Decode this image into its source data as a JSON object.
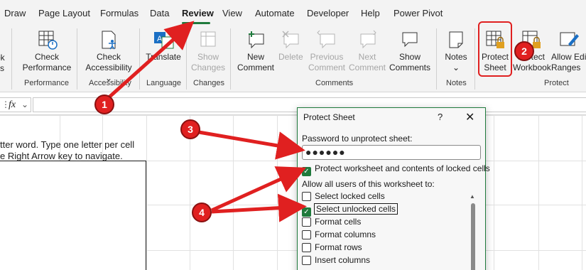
{
  "menu": {
    "tabs": [
      "Draw",
      "Page Layout",
      "Formulas",
      "Data",
      "Review",
      "View",
      "Automate",
      "Developer",
      "Help",
      "Power Pivot"
    ],
    "active_tab": "Review"
  },
  "ribbon": {
    "clipped_left": {
      "line1": "ok",
      "line2": "cs"
    },
    "check_performance": "Check Performance",
    "check_accessibility": "Check Accessibility",
    "translate": "Translate",
    "show_changes": "Show Changes",
    "new_comment": "New Comment",
    "delete": "Delete",
    "previous_comment": "Previous Comment",
    "next_comment": "Next Comment",
    "show_comments": "Show Comments",
    "notes": "Notes",
    "protect_sheet": "Protect Sheet",
    "protect_workbook": "Protect Workbook",
    "allow_edit_ranges": "Allow Edi Ranges",
    "groups": {
      "performance": "Performance",
      "accessibility": "Accessibility",
      "language": "Language",
      "changes": "Changes",
      "comments": "Comments",
      "notes": "Notes",
      "protect": "Protect"
    }
  },
  "formula_bar": {
    "fx": "fx",
    "value": ""
  },
  "sheet": {
    "line1": "tter word. Type one letter per cell",
    "line2": "e Right Arrow key to navigate."
  },
  "dialog": {
    "title": "Protect Sheet",
    "help": "?",
    "close": "✕",
    "password_label": "Password to unprotect sheet:",
    "password_value": "●●●●●●",
    "protect_contents": {
      "label": "Protect worksheet and contents of locked cells",
      "checked": true
    },
    "allow_label": "Allow all users of this worksheet to:",
    "options": [
      {
        "label": "Select locked cells",
        "checked": false
      },
      {
        "label": "Select unlocked cells",
        "checked": true
      },
      {
        "label": "Format cells",
        "checked": false
      },
      {
        "label": "Format columns",
        "checked": false
      },
      {
        "label": "Format rows",
        "checked": false
      },
      {
        "label": "Insert columns",
        "checked": false
      }
    ]
  },
  "annotations": {
    "m1": "1",
    "m2": "2",
    "m3": "3",
    "m4": "4"
  },
  "colors": {
    "accent_green": "#1f7a3c",
    "annotation_red": "#e02020"
  }
}
